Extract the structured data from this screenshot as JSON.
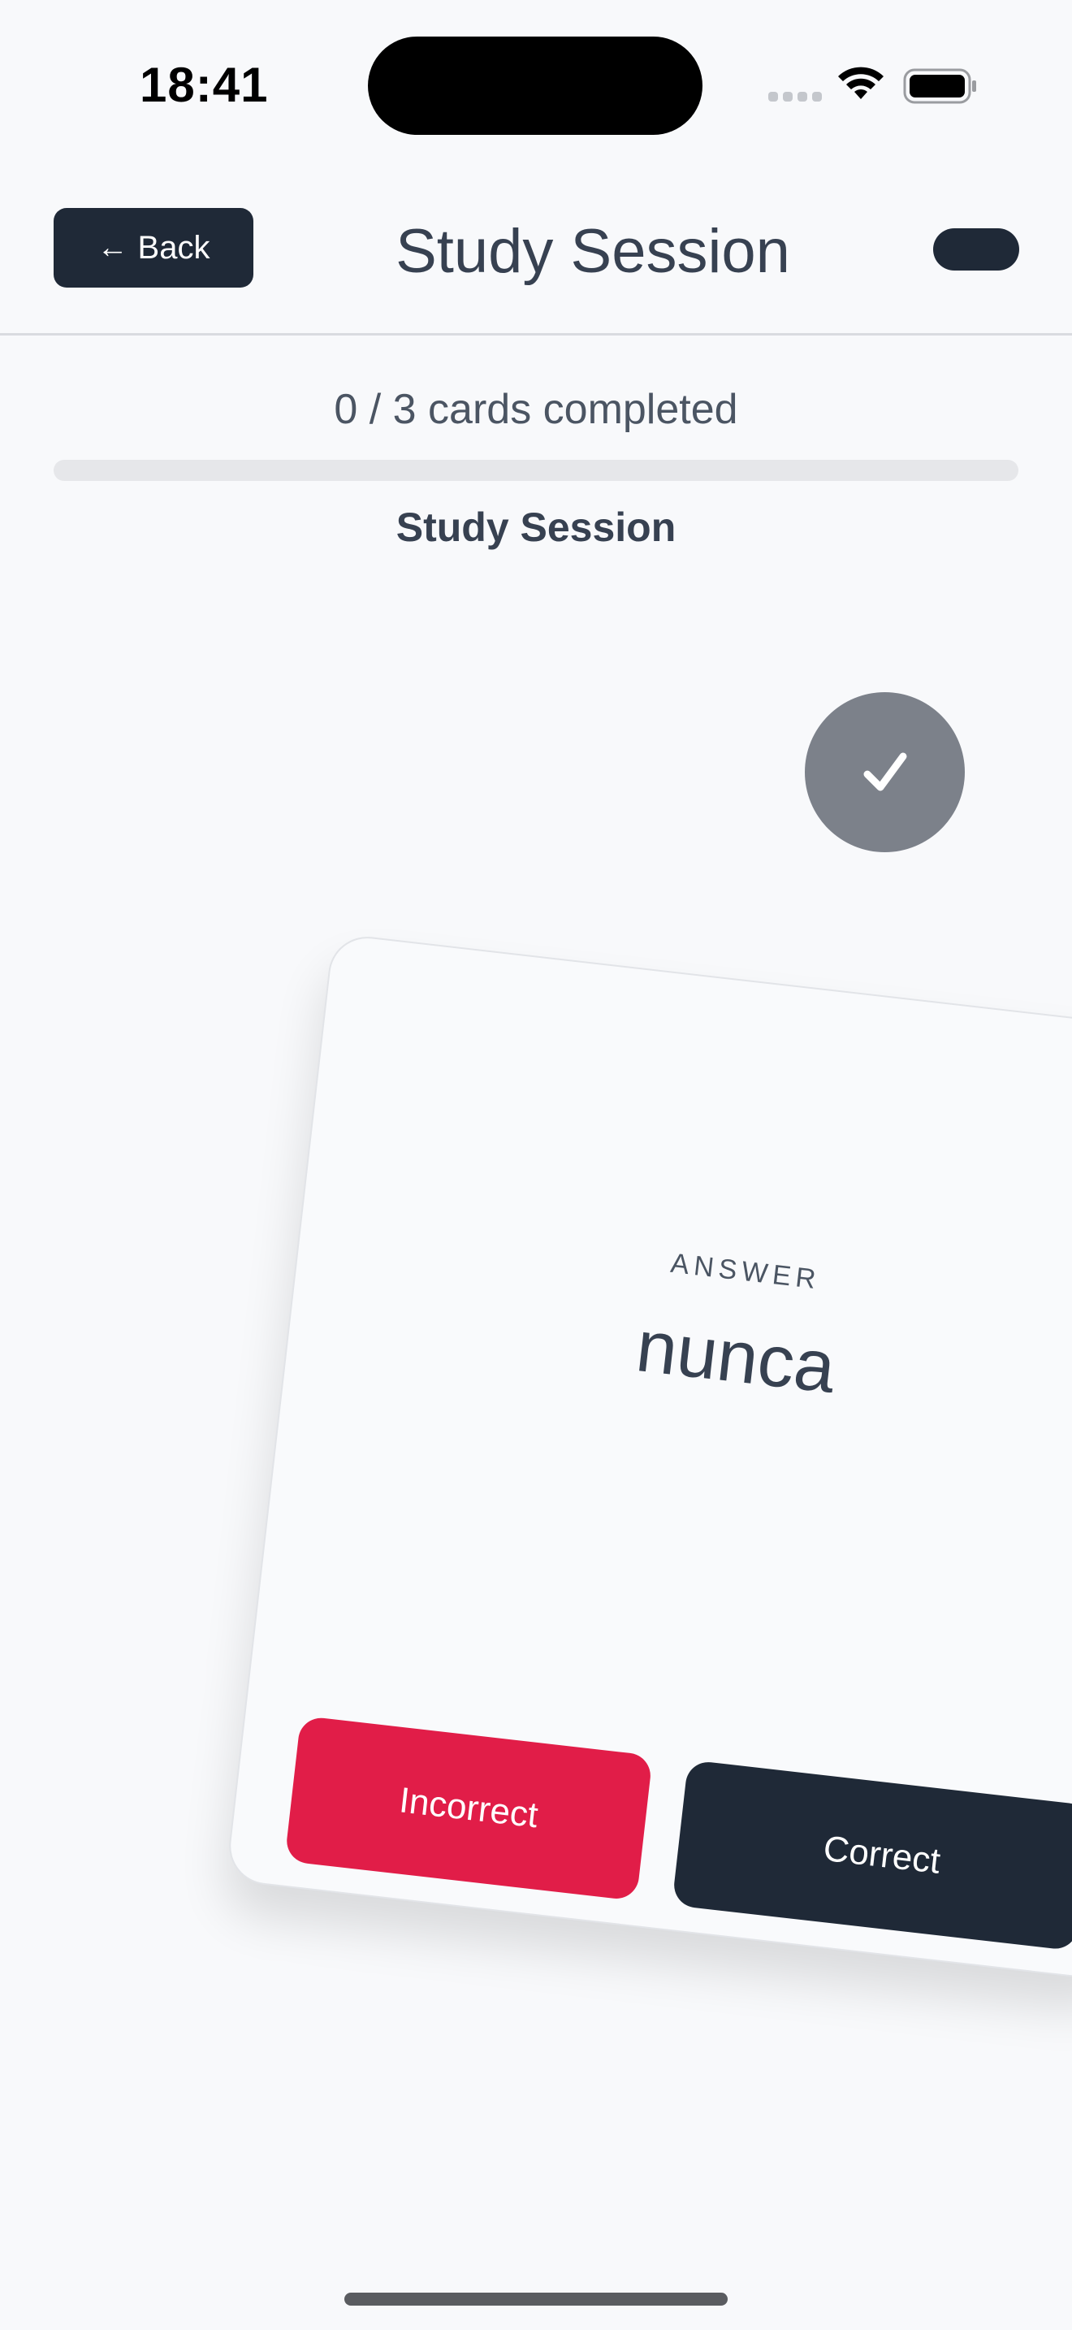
{
  "status_bar": {
    "time": "18:41"
  },
  "header": {
    "back_arrow": "←",
    "back_label": "Back",
    "title": "Study Session"
  },
  "progress": {
    "text": "0 / 3 cards completed",
    "fraction": 0
  },
  "session_label": "Study Session",
  "card": {
    "label": "ANSWER",
    "word": "nunca",
    "incorrect_label": "Incorrect",
    "correct_label": "Correct"
  },
  "icons": {
    "check": "check-icon",
    "wifi": "wifi-icon",
    "battery": "battery-icon",
    "signal": "cellular-signal-icon",
    "back_arrow": "arrow-left-icon"
  },
  "colors": {
    "primary": "#1f2937",
    "danger": "#e11d48",
    "check_circle": "#7c818a",
    "background": "#f8f9fb"
  }
}
